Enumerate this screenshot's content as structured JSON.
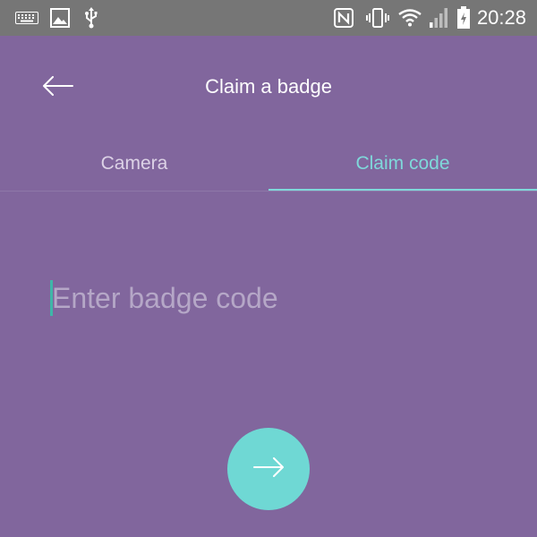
{
  "status_bar": {
    "time": "20:28",
    "icons": [
      "keyboard-icon",
      "image-icon",
      "usb-icon",
      "nfc-icon",
      "vibrate-icon",
      "wifi-icon",
      "signal-icon",
      "battery-icon"
    ]
  },
  "app_bar": {
    "title": "Claim a badge",
    "back_icon": "arrow-left-icon"
  },
  "tabs": [
    {
      "label": "Camera",
      "selected": false
    },
    {
      "label": "Claim code",
      "selected": true
    }
  ],
  "form": {
    "code_placeholder": "Enter badge code",
    "code_value": "",
    "submit_icon": "arrow-right-icon"
  },
  "colors": {
    "background": "#81669D",
    "status_bar": "#767676",
    "accent": "#7FD8DA",
    "fab": "#6FD8D4",
    "caret": "#3FB6A8"
  }
}
